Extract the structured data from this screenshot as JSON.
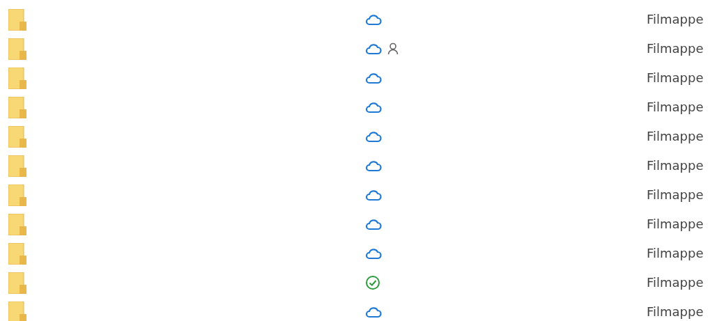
{
  "rows": [
    {
      "kind": "cloud",
      "shared": false,
      "type": "Filmappe"
    },
    {
      "kind": "cloud",
      "shared": true,
      "type": "Filmappe"
    },
    {
      "kind": "cloud",
      "shared": false,
      "type": "Filmappe"
    },
    {
      "kind": "cloud",
      "shared": false,
      "type": "Filmappe"
    },
    {
      "kind": "cloud",
      "shared": false,
      "type": "Filmappe"
    },
    {
      "kind": "cloud",
      "shared": false,
      "type": "Filmappe"
    },
    {
      "kind": "cloud",
      "shared": false,
      "type": "Filmappe"
    },
    {
      "kind": "cloud",
      "shared": false,
      "type": "Filmappe"
    },
    {
      "kind": "cloud",
      "shared": false,
      "type": "Filmappe"
    },
    {
      "kind": "synced",
      "shared": false,
      "type": "Filmappe"
    },
    {
      "kind": "cloud",
      "shared": false,
      "type": "Filmappe"
    }
  ]
}
